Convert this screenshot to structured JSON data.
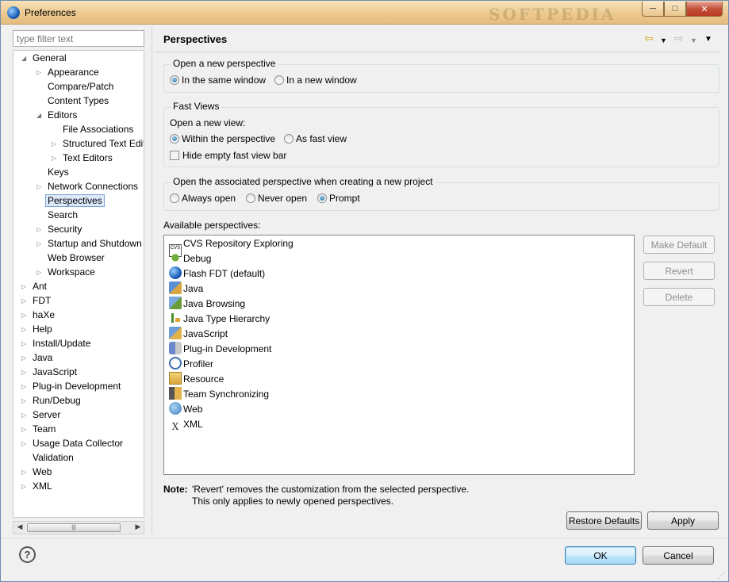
{
  "window": {
    "title": "Preferences"
  },
  "watermark": "SOFTPEDIA",
  "filter": {
    "placeholder": "type filter text"
  },
  "tree": [
    {
      "label": "General",
      "level": 0,
      "twisty": "open"
    },
    {
      "label": "Appearance",
      "level": 1,
      "twisty": "closed"
    },
    {
      "label": "Compare/Patch",
      "level": 1,
      "twisty": ""
    },
    {
      "label": "Content Types",
      "level": 1,
      "twisty": ""
    },
    {
      "label": "Editors",
      "level": 1,
      "twisty": "open"
    },
    {
      "label": "File Associations",
      "level": 2,
      "twisty": ""
    },
    {
      "label": "Structured Text Edit",
      "level": 2,
      "twisty": "closed"
    },
    {
      "label": "Text Editors",
      "level": 2,
      "twisty": "closed"
    },
    {
      "label": "Keys",
      "level": 1,
      "twisty": ""
    },
    {
      "label": "Network Connections",
      "level": 1,
      "twisty": "closed"
    },
    {
      "label": "Perspectives",
      "level": 1,
      "twisty": "",
      "selected": true
    },
    {
      "label": "Search",
      "level": 1,
      "twisty": ""
    },
    {
      "label": "Security",
      "level": 1,
      "twisty": "closed"
    },
    {
      "label": "Startup and Shutdown",
      "level": 1,
      "twisty": "closed"
    },
    {
      "label": "Web Browser",
      "level": 1,
      "twisty": ""
    },
    {
      "label": "Workspace",
      "level": 1,
      "twisty": "closed"
    },
    {
      "label": "Ant",
      "level": 0,
      "twisty": "closed"
    },
    {
      "label": "FDT",
      "level": 0,
      "twisty": "closed"
    },
    {
      "label": "haXe",
      "level": 0,
      "twisty": "closed"
    },
    {
      "label": "Help",
      "level": 0,
      "twisty": "closed"
    },
    {
      "label": "Install/Update",
      "level": 0,
      "twisty": "closed"
    },
    {
      "label": "Java",
      "level": 0,
      "twisty": "closed"
    },
    {
      "label": "JavaScript",
      "level": 0,
      "twisty": "closed"
    },
    {
      "label": "Plug-in Development",
      "level": 0,
      "twisty": "closed"
    },
    {
      "label": "Run/Debug",
      "level": 0,
      "twisty": "closed"
    },
    {
      "label": "Server",
      "level": 0,
      "twisty": "closed"
    },
    {
      "label": "Team",
      "level": 0,
      "twisty": "closed"
    },
    {
      "label": "Usage Data Collector",
      "level": 0,
      "twisty": "closed"
    },
    {
      "label": "Validation",
      "level": 0,
      "twisty": ""
    },
    {
      "label": "Web",
      "level": 0,
      "twisty": "closed"
    },
    {
      "label": "XML",
      "level": 0,
      "twisty": "closed"
    }
  ],
  "page": {
    "title": "Perspectives",
    "open_new": {
      "title": "Open a new perspective",
      "same_window": "In the same window",
      "new_window": "In a new window",
      "selected": "same_window"
    },
    "fast_views": {
      "title": "Fast Views",
      "open_new_view": "Open a new view:",
      "within": "Within the perspective",
      "as_fast": "As fast view",
      "selected": "within",
      "hide_bar": "Hide empty fast view bar",
      "hide_bar_checked": false
    },
    "associated": {
      "title": "Open the associated perspective when creating a new project",
      "always": "Always open",
      "never": "Never open",
      "prompt": "Prompt",
      "selected": "prompt"
    },
    "available_label": "Available perspectives:",
    "perspectives": [
      {
        "label": "CVS Repository Exploring",
        "icon": "cvs-icon"
      },
      {
        "label": "Debug",
        "icon": "debug-icon"
      },
      {
        "label": "Flash FDT (default)",
        "icon": "fdt-icon"
      },
      {
        "label": "Java",
        "icon": "java-icon"
      },
      {
        "label": "Java Browsing",
        "icon": "java-browsing-icon"
      },
      {
        "label": "Java Type Hierarchy",
        "icon": "hierarchy-icon"
      },
      {
        "label": "JavaScript",
        "icon": "javascript-icon"
      },
      {
        "label": "Plug-in Development",
        "icon": "plugin-icon"
      },
      {
        "label": "Profiler",
        "icon": "profiler-icon"
      },
      {
        "label": "Resource",
        "icon": "resource-icon"
      },
      {
        "label": "Team Synchronizing",
        "icon": "team-sync-icon"
      },
      {
        "label": "Web",
        "icon": "web-icon"
      },
      {
        "label": "XML",
        "icon": "xml-icon"
      }
    ],
    "make_default": "Make Default",
    "revert": "Revert",
    "delete": "Delete",
    "note_label": "Note:",
    "note_line1": "'Revert' removes the customization from the selected perspective.",
    "note_line2": "This only applies to newly opened perspectives.",
    "restore_defaults": "Restore Defaults",
    "apply": "Apply"
  },
  "footer": {
    "ok": "OK",
    "cancel": "Cancel",
    "help_glyph": "?"
  }
}
